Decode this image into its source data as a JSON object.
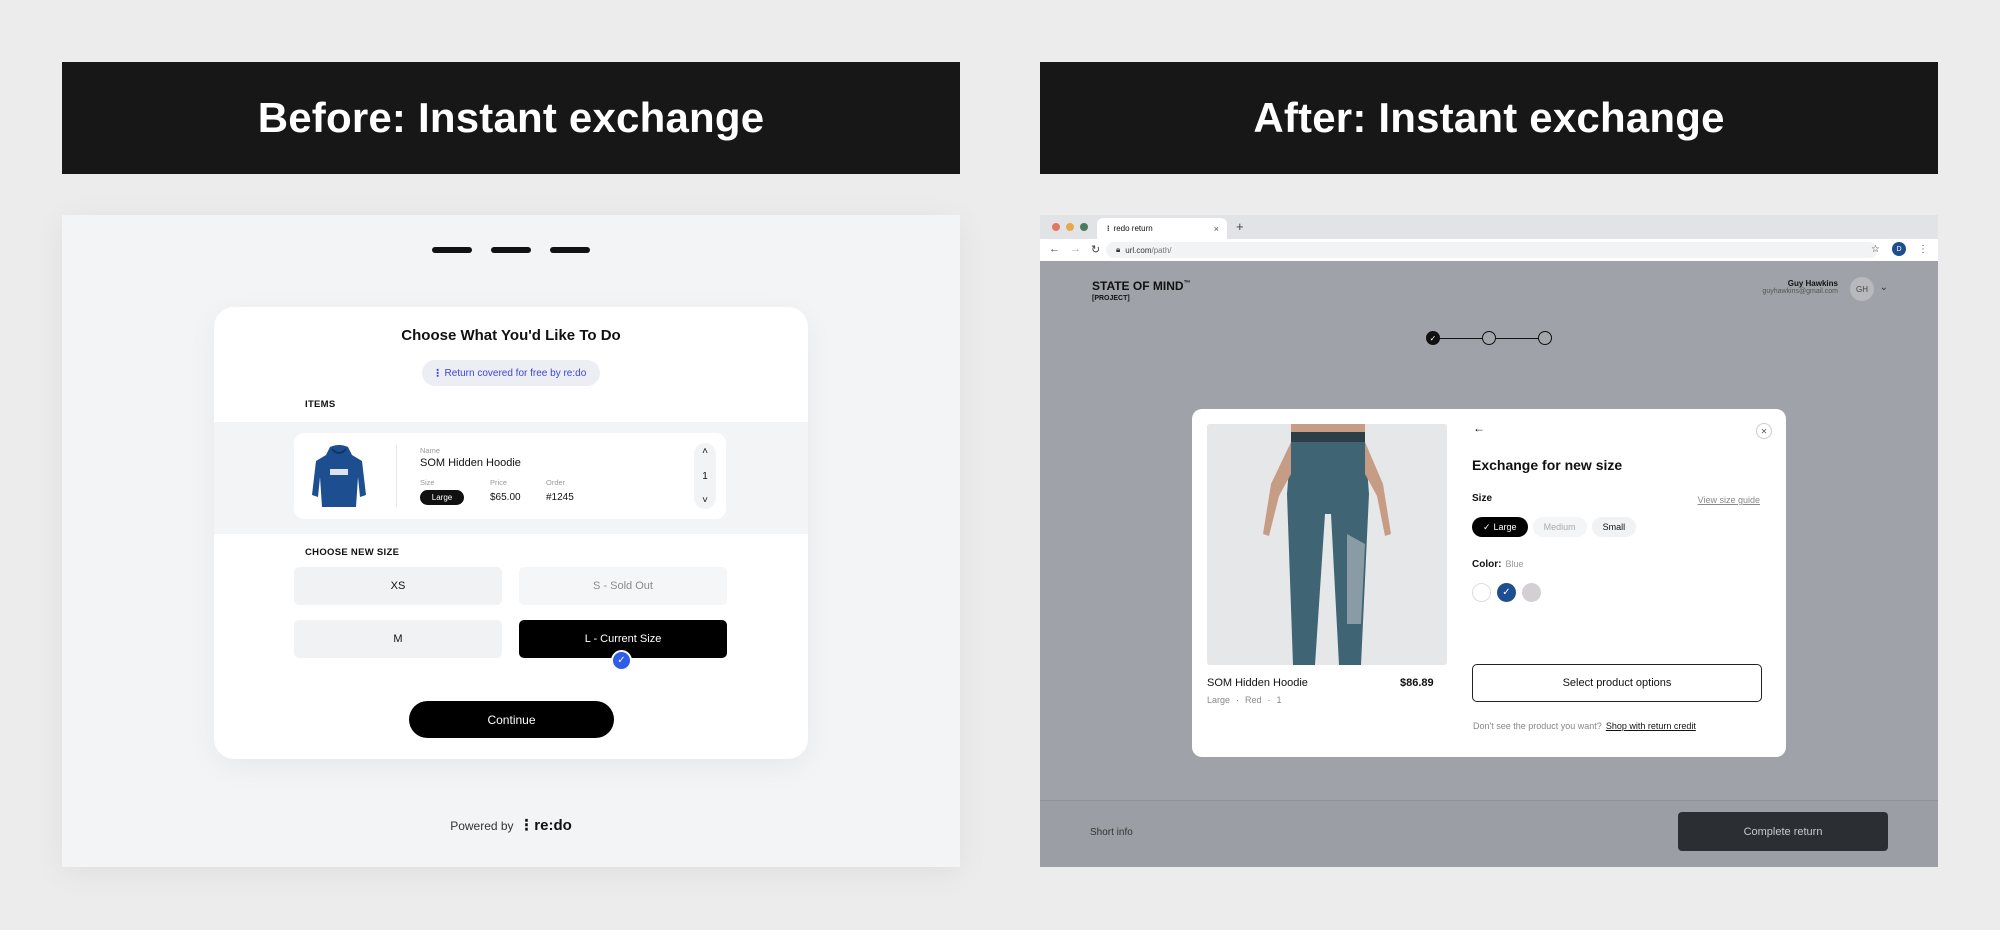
{
  "headers": {
    "before": "Before: Instant exchange",
    "after": "After: Instant exchange"
  },
  "before": {
    "card_title": "Choose What You'd Like To Do",
    "coverage_pill": "Return covered for free by re:do",
    "items_label": "ITEMS",
    "item": {
      "name_label": "Name",
      "name": "SOM Hidden Hoodie",
      "size_label": "Size",
      "size": "Large",
      "price_label": "Price",
      "price": "$65.00",
      "order_label": "Order",
      "order": "#1245",
      "quantity": "1",
      "hoodie_color": "#1d4e8f"
    },
    "choose_size_label": "CHOOSE NEW SIZE",
    "size_options": {
      "xs": "XS",
      "s": "S - Sold Out",
      "m": "M",
      "l": "L - Current Size"
    },
    "continue_label": "Continue",
    "powered_by": "Powered by",
    "brand": "re:do"
  },
  "after": {
    "browser": {
      "tab_title": "redo return",
      "url_domain": "url.com",
      "url_path": "/path/",
      "profile_initial": "D"
    },
    "site": {
      "brand": "STATE OF MIND",
      "brand_tm": "™",
      "brand_sub": "[PROJECT]",
      "user_name": "Guy Hawkins",
      "user_email": "guyhawkins@gmail.com",
      "avatar_initials": "GH",
      "short_info": "Short info",
      "complete_label": "Complete return"
    },
    "modal": {
      "title": "Exchange for new size",
      "size_label": "Size",
      "size_guide": "View size guide",
      "sizes": [
        {
          "label": "Large",
          "state": "selected"
        },
        {
          "label": "Medium",
          "state": "disabled"
        },
        {
          "label": "Small",
          "state": "available"
        }
      ],
      "color_label": "Color:",
      "color_value": "Blue",
      "swatches": [
        {
          "color": "#ffffff",
          "selected": false
        },
        {
          "color": "#1d4e8f",
          "selected": true
        },
        {
          "color": "#d4cfd3",
          "selected": false
        }
      ],
      "product_name": "SOM Hidden Hoodie",
      "product_price": "$86.89",
      "product_meta": [
        "Large",
        "Red",
        "1"
      ],
      "select_btn": "Select product options",
      "footer_question": "Don't see the product you want?",
      "footer_link": "Shop with return credit"
    }
  },
  "colors": {
    "accent_blue": "#2f5ce8",
    "legging": "#3f6474"
  }
}
